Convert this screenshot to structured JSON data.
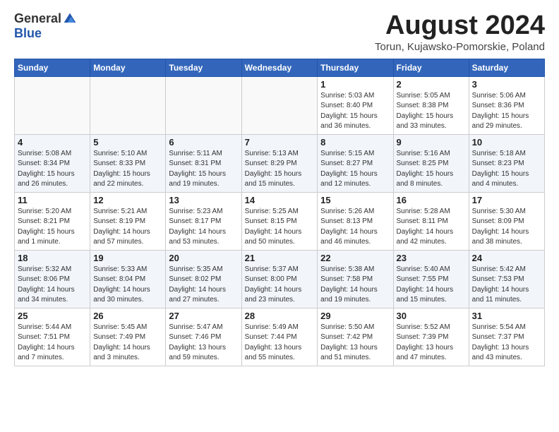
{
  "logo": {
    "general": "General",
    "blue": "Blue"
  },
  "title": {
    "month_year": "August 2024",
    "location": "Torun, Kujawsko-Pomorskie, Poland"
  },
  "weekdays": [
    "Sunday",
    "Monday",
    "Tuesday",
    "Wednesday",
    "Thursday",
    "Friday",
    "Saturday"
  ],
  "weeks": [
    [
      {
        "day": "",
        "info": ""
      },
      {
        "day": "",
        "info": ""
      },
      {
        "day": "",
        "info": ""
      },
      {
        "day": "",
        "info": ""
      },
      {
        "day": "1",
        "info": "Sunrise: 5:03 AM\nSunset: 8:40 PM\nDaylight: 15 hours\nand 36 minutes."
      },
      {
        "day": "2",
        "info": "Sunrise: 5:05 AM\nSunset: 8:38 PM\nDaylight: 15 hours\nand 33 minutes."
      },
      {
        "day": "3",
        "info": "Sunrise: 5:06 AM\nSunset: 8:36 PM\nDaylight: 15 hours\nand 29 minutes."
      }
    ],
    [
      {
        "day": "4",
        "info": "Sunrise: 5:08 AM\nSunset: 8:34 PM\nDaylight: 15 hours\nand 26 minutes."
      },
      {
        "day": "5",
        "info": "Sunrise: 5:10 AM\nSunset: 8:33 PM\nDaylight: 15 hours\nand 22 minutes."
      },
      {
        "day": "6",
        "info": "Sunrise: 5:11 AM\nSunset: 8:31 PM\nDaylight: 15 hours\nand 19 minutes."
      },
      {
        "day": "7",
        "info": "Sunrise: 5:13 AM\nSunset: 8:29 PM\nDaylight: 15 hours\nand 15 minutes."
      },
      {
        "day": "8",
        "info": "Sunrise: 5:15 AM\nSunset: 8:27 PM\nDaylight: 15 hours\nand 12 minutes."
      },
      {
        "day": "9",
        "info": "Sunrise: 5:16 AM\nSunset: 8:25 PM\nDaylight: 15 hours\nand 8 minutes."
      },
      {
        "day": "10",
        "info": "Sunrise: 5:18 AM\nSunset: 8:23 PM\nDaylight: 15 hours\nand 4 minutes."
      }
    ],
    [
      {
        "day": "11",
        "info": "Sunrise: 5:20 AM\nSunset: 8:21 PM\nDaylight: 15 hours\nand 1 minute."
      },
      {
        "day": "12",
        "info": "Sunrise: 5:21 AM\nSunset: 8:19 PM\nDaylight: 14 hours\nand 57 minutes."
      },
      {
        "day": "13",
        "info": "Sunrise: 5:23 AM\nSunset: 8:17 PM\nDaylight: 14 hours\nand 53 minutes."
      },
      {
        "day": "14",
        "info": "Sunrise: 5:25 AM\nSunset: 8:15 PM\nDaylight: 14 hours\nand 50 minutes."
      },
      {
        "day": "15",
        "info": "Sunrise: 5:26 AM\nSunset: 8:13 PM\nDaylight: 14 hours\nand 46 minutes."
      },
      {
        "day": "16",
        "info": "Sunrise: 5:28 AM\nSunset: 8:11 PM\nDaylight: 14 hours\nand 42 minutes."
      },
      {
        "day": "17",
        "info": "Sunrise: 5:30 AM\nSunset: 8:09 PM\nDaylight: 14 hours\nand 38 minutes."
      }
    ],
    [
      {
        "day": "18",
        "info": "Sunrise: 5:32 AM\nSunset: 8:06 PM\nDaylight: 14 hours\nand 34 minutes."
      },
      {
        "day": "19",
        "info": "Sunrise: 5:33 AM\nSunset: 8:04 PM\nDaylight: 14 hours\nand 30 minutes."
      },
      {
        "day": "20",
        "info": "Sunrise: 5:35 AM\nSunset: 8:02 PM\nDaylight: 14 hours\nand 27 minutes."
      },
      {
        "day": "21",
        "info": "Sunrise: 5:37 AM\nSunset: 8:00 PM\nDaylight: 14 hours\nand 23 minutes."
      },
      {
        "day": "22",
        "info": "Sunrise: 5:38 AM\nSunset: 7:58 PM\nDaylight: 14 hours\nand 19 minutes."
      },
      {
        "day": "23",
        "info": "Sunrise: 5:40 AM\nSunset: 7:55 PM\nDaylight: 14 hours\nand 15 minutes."
      },
      {
        "day": "24",
        "info": "Sunrise: 5:42 AM\nSunset: 7:53 PM\nDaylight: 14 hours\nand 11 minutes."
      }
    ],
    [
      {
        "day": "25",
        "info": "Sunrise: 5:44 AM\nSunset: 7:51 PM\nDaylight: 14 hours\nand 7 minutes."
      },
      {
        "day": "26",
        "info": "Sunrise: 5:45 AM\nSunset: 7:49 PM\nDaylight: 14 hours\nand 3 minutes."
      },
      {
        "day": "27",
        "info": "Sunrise: 5:47 AM\nSunset: 7:46 PM\nDaylight: 13 hours\nand 59 minutes."
      },
      {
        "day": "28",
        "info": "Sunrise: 5:49 AM\nSunset: 7:44 PM\nDaylight: 13 hours\nand 55 minutes."
      },
      {
        "day": "29",
        "info": "Sunrise: 5:50 AM\nSunset: 7:42 PM\nDaylight: 13 hours\nand 51 minutes."
      },
      {
        "day": "30",
        "info": "Sunrise: 5:52 AM\nSunset: 7:39 PM\nDaylight: 13 hours\nand 47 minutes."
      },
      {
        "day": "31",
        "info": "Sunrise: 5:54 AM\nSunset: 7:37 PM\nDaylight: 13 hours\nand 43 minutes."
      }
    ]
  ]
}
